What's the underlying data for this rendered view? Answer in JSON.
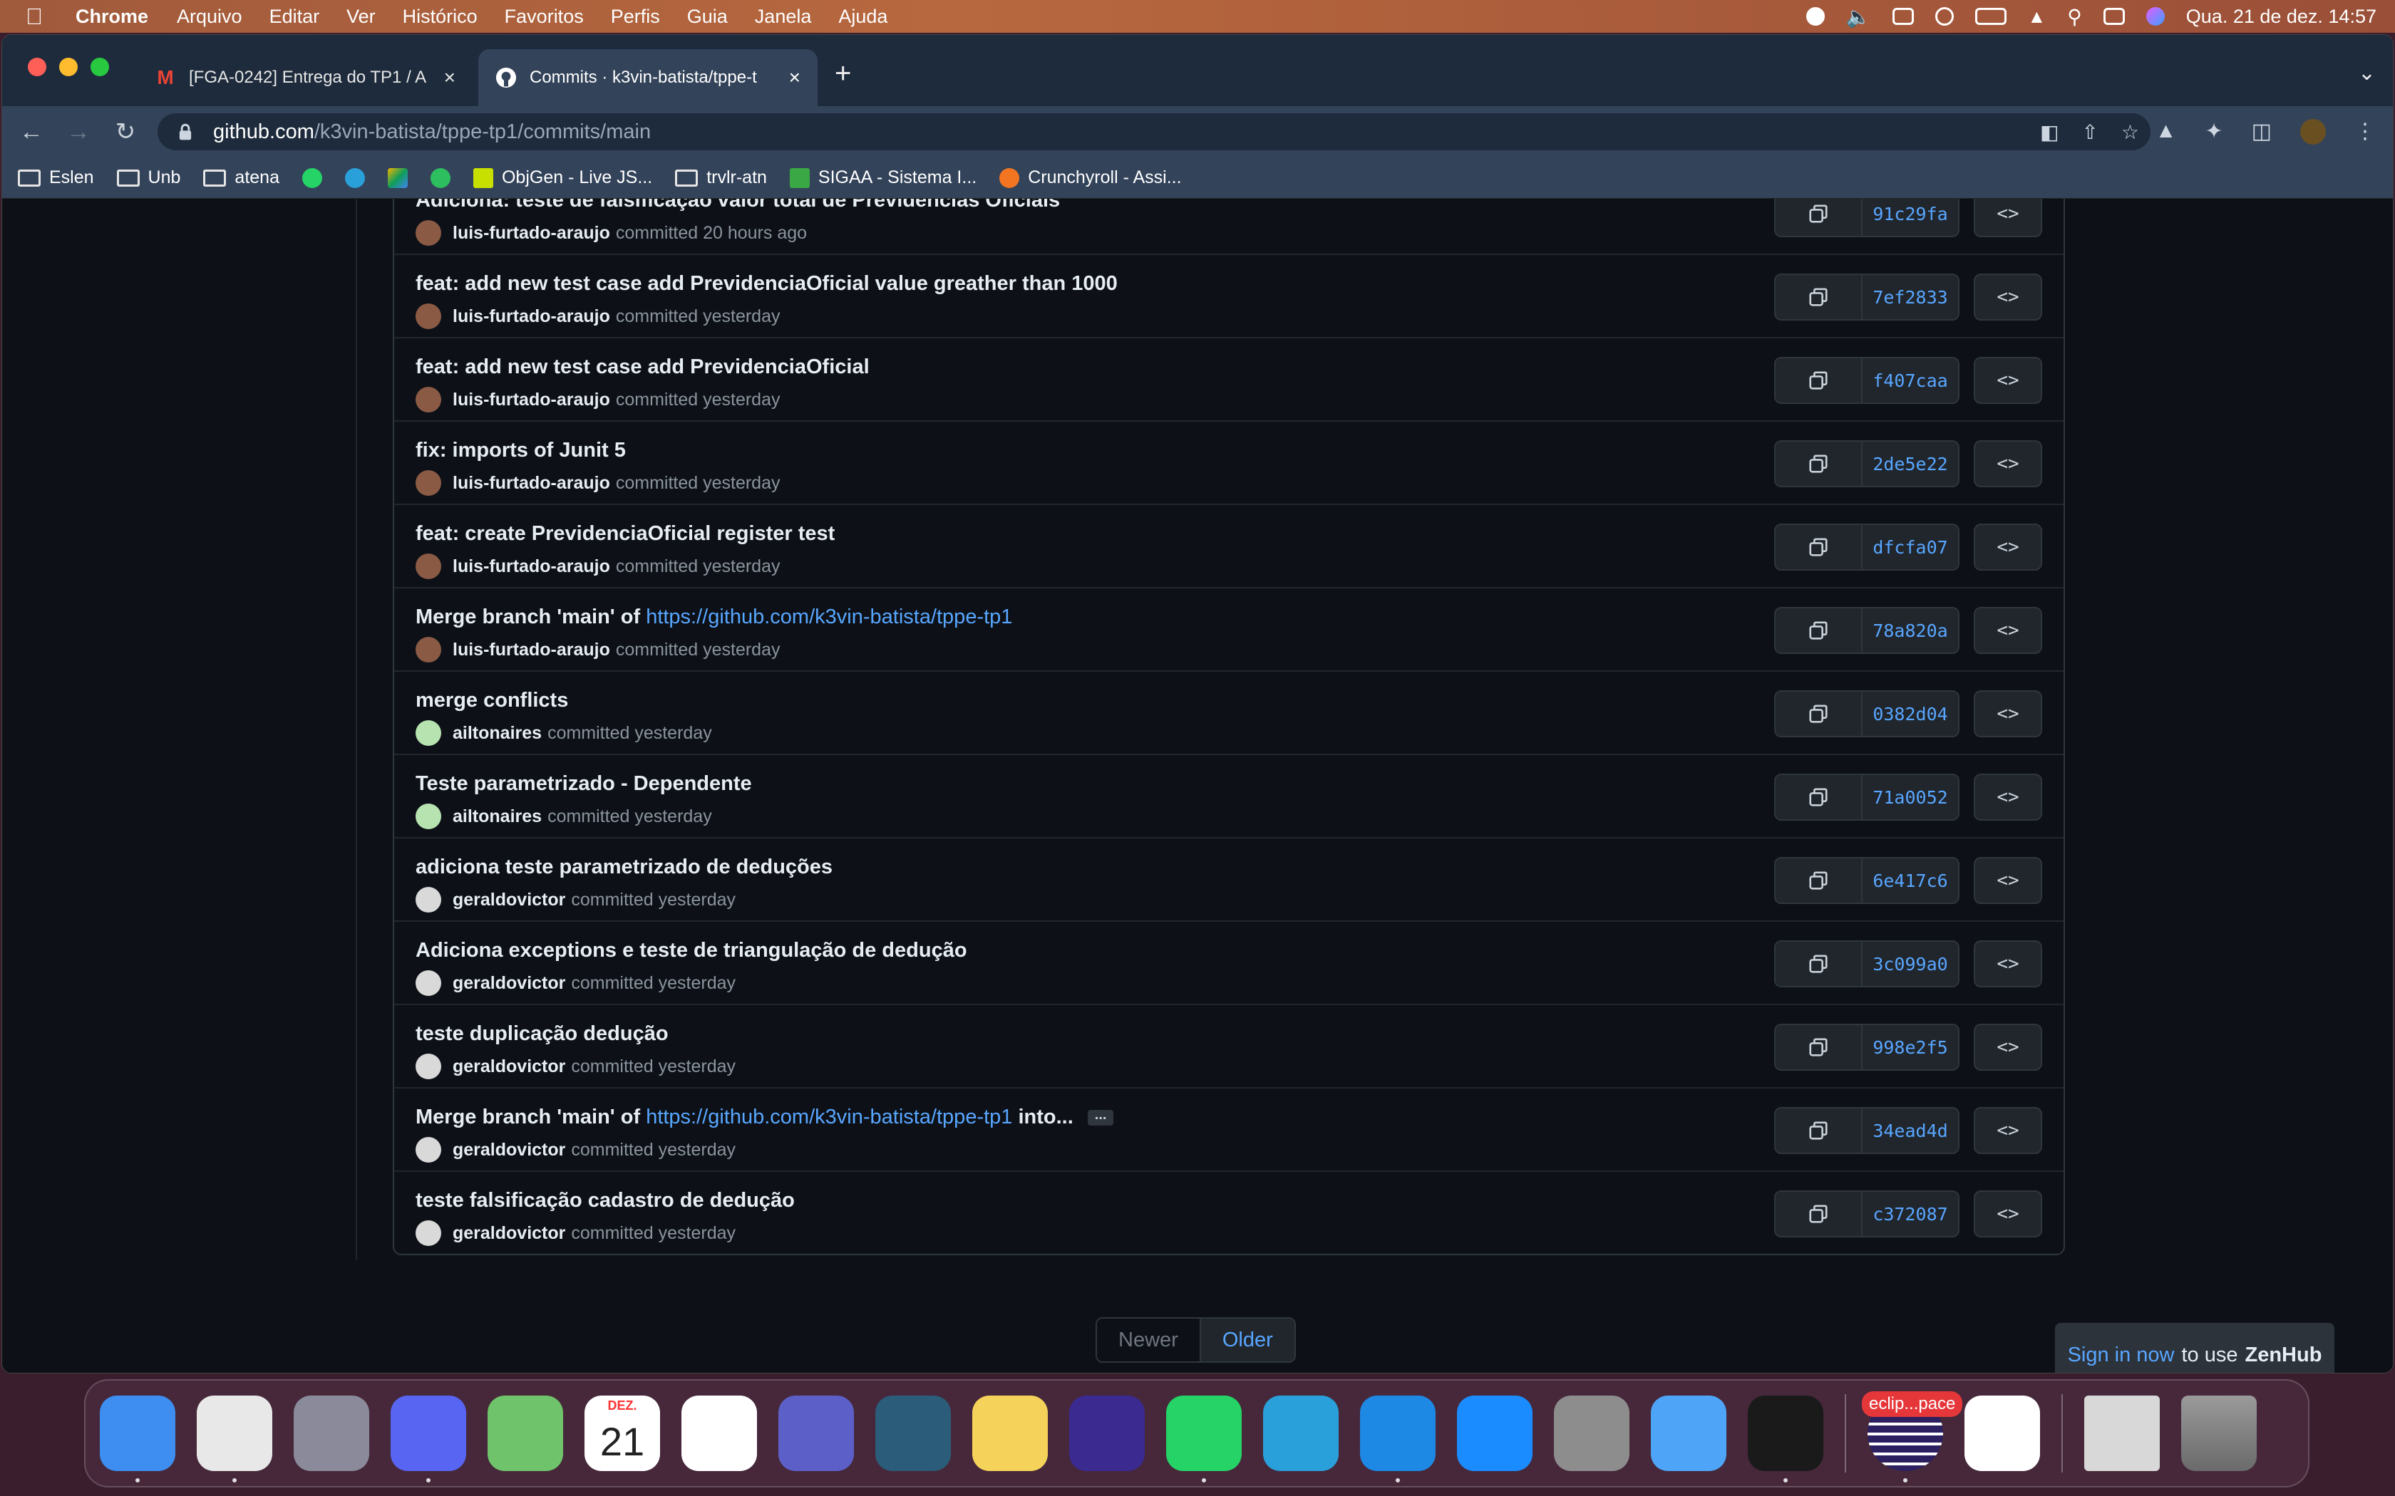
{
  "menubar": {
    "app": "Chrome",
    "items": [
      "Arquivo",
      "Editar",
      "Ver",
      "Histórico",
      "Favoritos",
      "Perfis",
      "Guia",
      "Janela",
      "Ajuda"
    ],
    "clock": "Qua. 21 de dez.  14:57"
  },
  "tabs": [
    {
      "title": "[FGA-0242] Entrega do TP1 / A",
      "icon": "gmail-icon"
    },
    {
      "title": "Commits · k3vin-batista/tppe-t",
      "icon": "github-icon"
    }
  ],
  "address": {
    "host": "github.com",
    "path": "/k3vin-batista/tppe-tp1/commits/main"
  },
  "bookmarks": [
    {
      "label": "Eslen",
      "type": "folder"
    },
    {
      "label": "Unb",
      "type": "folder"
    },
    {
      "label": "atena",
      "type": "folder"
    },
    {
      "label": "",
      "type": "whatsapp",
      "color": "#25d366"
    },
    {
      "label": "",
      "type": "telegram",
      "color": "#2aa0da"
    },
    {
      "label": "",
      "type": "drive",
      "color": "#f4b400"
    },
    {
      "label": "",
      "type": "evernote",
      "color": "#2dbe60"
    },
    {
      "label": "ObjGen - Live JS...",
      "type": "site",
      "color": "#c8e000"
    },
    {
      "label": "trvlr-atn",
      "type": "folder"
    },
    {
      "label": "SIGAA - Sistema I...",
      "type": "site",
      "color": "#3aa845"
    },
    {
      "label": "Crunchyroll - Assi...",
      "type": "site",
      "color": "#f47521"
    }
  ],
  "commits": [
    {
      "message": "Adiciona: teste de falsificação valor total de Previdencias Oficiais",
      "link": "",
      "suffix": "",
      "author": "luis-furtado-araujo",
      "when": "committed 20 hours ago",
      "sha": "91c29fa",
      "avatar": "#8a5a44",
      "ellipsis": ""
    },
    {
      "message": "feat: add new test case add PrevidenciaOficial value greather than 1000",
      "link": "",
      "suffix": "",
      "author": "luis-furtado-araujo",
      "when": "committed yesterday",
      "sha": "7ef2833",
      "avatar": "#8a5a44",
      "ellipsis": ""
    },
    {
      "message": "feat: add new test case add PrevidenciaOficial",
      "link": "",
      "suffix": "",
      "author": "luis-furtado-araujo",
      "when": "committed yesterday",
      "sha": "f407caa",
      "avatar": "#8a5a44",
      "ellipsis": ""
    },
    {
      "message": "fix: imports of Junit 5",
      "link": "",
      "suffix": "",
      "author": "luis-furtado-araujo",
      "when": "committed yesterday",
      "sha": "2de5e22",
      "avatar": "#8a5a44",
      "ellipsis": ""
    },
    {
      "message": "feat: create PrevidenciaOficial register test",
      "link": "",
      "suffix": "",
      "author": "luis-furtado-araujo",
      "when": "committed yesterday",
      "sha": "dfcfa07",
      "avatar": "#8a5a44",
      "ellipsis": ""
    },
    {
      "message": "Merge branch 'main' of ",
      "link": "https://github.com/k3vin-batista/tppe-tp1",
      "suffix": "",
      "author": "luis-furtado-araujo",
      "when": "committed yesterday",
      "sha": "78a820a",
      "avatar": "#8a5a44",
      "ellipsis": ""
    },
    {
      "message": "merge conflicts",
      "link": "",
      "suffix": "",
      "author": "ailtonaires",
      "when": "committed yesterday",
      "sha": "0382d04",
      "avatar": "#b7e3b0",
      "ellipsis": ""
    },
    {
      "message": "Teste parametrizado - Dependente",
      "link": "",
      "suffix": "",
      "author": "ailtonaires",
      "when": "committed yesterday",
      "sha": "71a0052",
      "avatar": "#b7e3b0",
      "ellipsis": ""
    },
    {
      "message": "adiciona teste parametrizado de deduções",
      "link": "",
      "suffix": "",
      "author": "geraldovictor",
      "when": "committed yesterday",
      "sha": "6e417c6",
      "avatar": "#d9d9d9",
      "ellipsis": ""
    },
    {
      "message": "Adiciona exceptions e teste de triangulação de dedução",
      "link": "",
      "suffix": "",
      "author": "geraldovictor",
      "when": "committed yesterday",
      "sha": "3c099a0",
      "avatar": "#d9d9d9",
      "ellipsis": ""
    },
    {
      "message": "teste duplicação dedução",
      "link": "",
      "suffix": "",
      "author": "geraldovictor",
      "when": "committed yesterday",
      "sha": "998e2f5",
      "avatar": "#d9d9d9",
      "ellipsis": ""
    },
    {
      "message": "Merge branch 'main' of ",
      "link": "https://github.com/k3vin-batista/tppe-tp1",
      "suffix": " into...",
      "author": "geraldovictor",
      "when": "committed yesterday",
      "sha": "34ead4d",
      "avatar": "#d9d9d9",
      "ellipsis": "..."
    },
    {
      "message": "teste falsificação cadastro de dedução",
      "link": "",
      "suffix": "",
      "author": "geraldovictor",
      "when": "committed yesterday",
      "sha": "c372087",
      "avatar": "#d9d9d9",
      "ellipsis": ""
    }
  ],
  "pagination": {
    "newer": "Newer",
    "older": "Older"
  },
  "zenhub": {
    "link": "Sign in now",
    "middle": "to use",
    "brand": "ZenHub"
  },
  "browse_label": "<>",
  "dock": {
    "calendar_month": "DEZ.",
    "calendar_day": "21",
    "eclipse_badge": "eclip...pace",
    "apps": [
      {
        "name": "finder",
        "color": "#3d8ef0",
        "running": true
      },
      {
        "name": "chrome",
        "color": "#e8e8e8",
        "running": true
      },
      {
        "name": "launchpad",
        "color": "#8a8a9a",
        "running": false
      },
      {
        "name": "discord",
        "color": "#5865f2",
        "running": true
      },
      {
        "name": "maps",
        "color": "#6fc36b",
        "running": false
      },
      {
        "name": "calendar",
        "color": "#ffffff",
        "running": false
      },
      {
        "name": "reminders",
        "color": "#ffffff",
        "running": false
      },
      {
        "name": "teams",
        "color": "#5b5fc7",
        "running": false
      },
      {
        "name": "mysql-workbench",
        "color": "#2b5c7a",
        "running": false
      },
      {
        "name": "notes",
        "color": "#f5d35b",
        "running": false
      },
      {
        "name": "eclipse-ide-round",
        "color": "#3b2a8f",
        "running": false
      },
      {
        "name": "whatsapp",
        "color": "#25d366",
        "running": true
      },
      {
        "name": "telegram",
        "color": "#2aa0da",
        "running": false
      },
      {
        "name": "vscode",
        "color": "#1e88e5",
        "running": true
      },
      {
        "name": "app-store",
        "color": "#1a8cff",
        "running": false
      },
      {
        "name": "system-settings",
        "color": "#8d8d8d",
        "running": false
      },
      {
        "name": "mail",
        "color": "#4ea5f7",
        "running": false
      },
      {
        "name": "terminal",
        "color": "#1a1a1a",
        "running": true
      }
    ]
  }
}
